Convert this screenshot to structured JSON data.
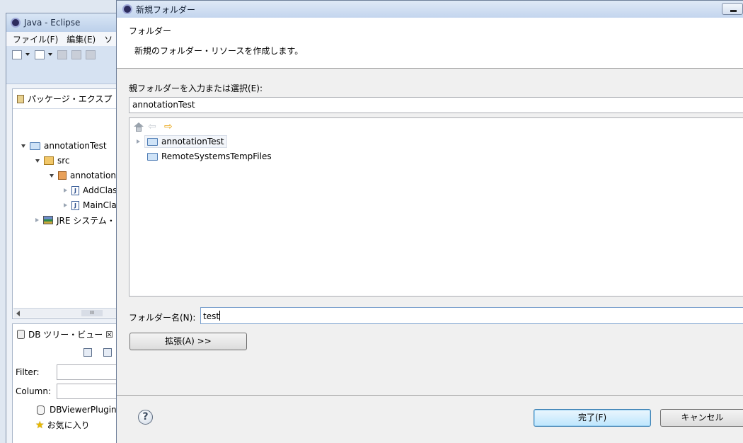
{
  "background_window": {
    "title": "Java - Eclipse",
    "menu": [
      "ファイル(F)",
      "編集(E)",
      "ソ"
    ],
    "package_explorer": {
      "tab_label": "パッケージ・エクスプ",
      "tree": [
        {
          "label": "annotationTest",
          "level": 0,
          "state": "expanded",
          "icon": "project-folder-icon"
        },
        {
          "label": "src",
          "level": 1,
          "state": "expanded",
          "icon": "source-folder-icon"
        },
        {
          "label": "annotation",
          "level": 2,
          "state": "expanded",
          "icon": "package-icon"
        },
        {
          "label": "AddClas",
          "level": 3,
          "state": "collapsed",
          "icon": "java-file-icon"
        },
        {
          "label": "MainCla",
          "level": 3,
          "state": "collapsed",
          "icon": "java-file-icon"
        },
        {
          "label": "JRE システム・",
          "level": 1,
          "state": "collapsed",
          "icon": "jre-library-icon"
        }
      ],
      "scroll_thumb": "III"
    },
    "db_tree_view": {
      "tab_label": "DB ツリー・ビュー ☒",
      "filter_label": "Filter:",
      "column_label": "Column:",
      "items": [
        "DBViewerPlugin",
        "お気に入り"
      ]
    }
  },
  "dialog": {
    "title": "新規フォルダー",
    "banner_title": "フォルダー",
    "banner_desc": "新規のフォルダー・リソースを作成します。",
    "parent_label": "親フォルダーを入力または選択(E):",
    "parent_value": "annotationTest",
    "tree": [
      {
        "label": "annotationTest",
        "state": "collapsed",
        "selected": true
      },
      {
        "label": "RemoteSystemsTempFiles",
        "state": "none",
        "selected": false
      }
    ],
    "folder_name_label": "フォルダー名(N):",
    "folder_name_value": "test",
    "advanced_button": "拡張(A) >>",
    "finish_button": "完了(F)",
    "cancel_button": "キャンセル",
    "help_glyph": "?"
  }
}
